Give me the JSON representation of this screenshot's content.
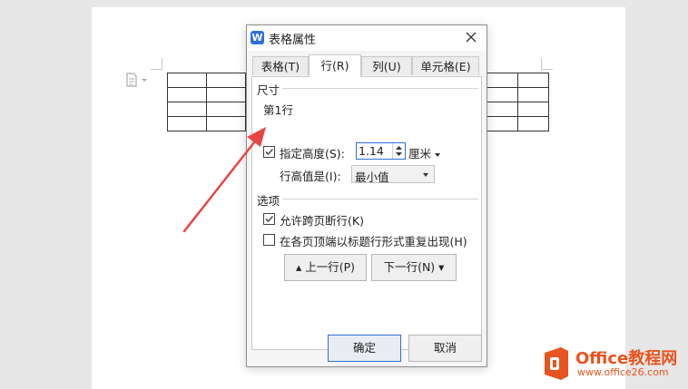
{
  "dialog": {
    "title": "表格属性",
    "app_icon_letter": "W",
    "tabs": [
      {
        "label": "表格(T)",
        "active": false
      },
      {
        "label": "行(R)",
        "active": true
      },
      {
        "label": "列(U)",
        "active": false
      },
      {
        "label": "单元格(E)",
        "active": false
      }
    ],
    "size_group": {
      "label": "尺寸",
      "row_label": "第1行",
      "specify_height": {
        "label": "指定高度(S):",
        "checked": true
      },
      "height_value": "1.14",
      "unit": "厘米",
      "row_height_mode": {
        "label": "行高值是(I):",
        "value": "最小值"
      }
    },
    "options_group": {
      "label": "选项",
      "allow_break": {
        "label": "允许跨页断行(K)",
        "checked": true
      },
      "repeat_header": {
        "label": "在各页顶端以标题行形式重复出现(H)",
        "checked": false
      }
    },
    "prev_row_button": "上一行(P)",
    "next_row_button": "下一行(N)",
    "ok_button": "确定",
    "cancel_button": "取消"
  },
  "watermark": {
    "title": "Office教程网",
    "url": "www.office26.com"
  },
  "colors": {
    "accent": "#2f6fd6",
    "annotation_arrow": "#e84545",
    "watermark": "#e8541d"
  }
}
